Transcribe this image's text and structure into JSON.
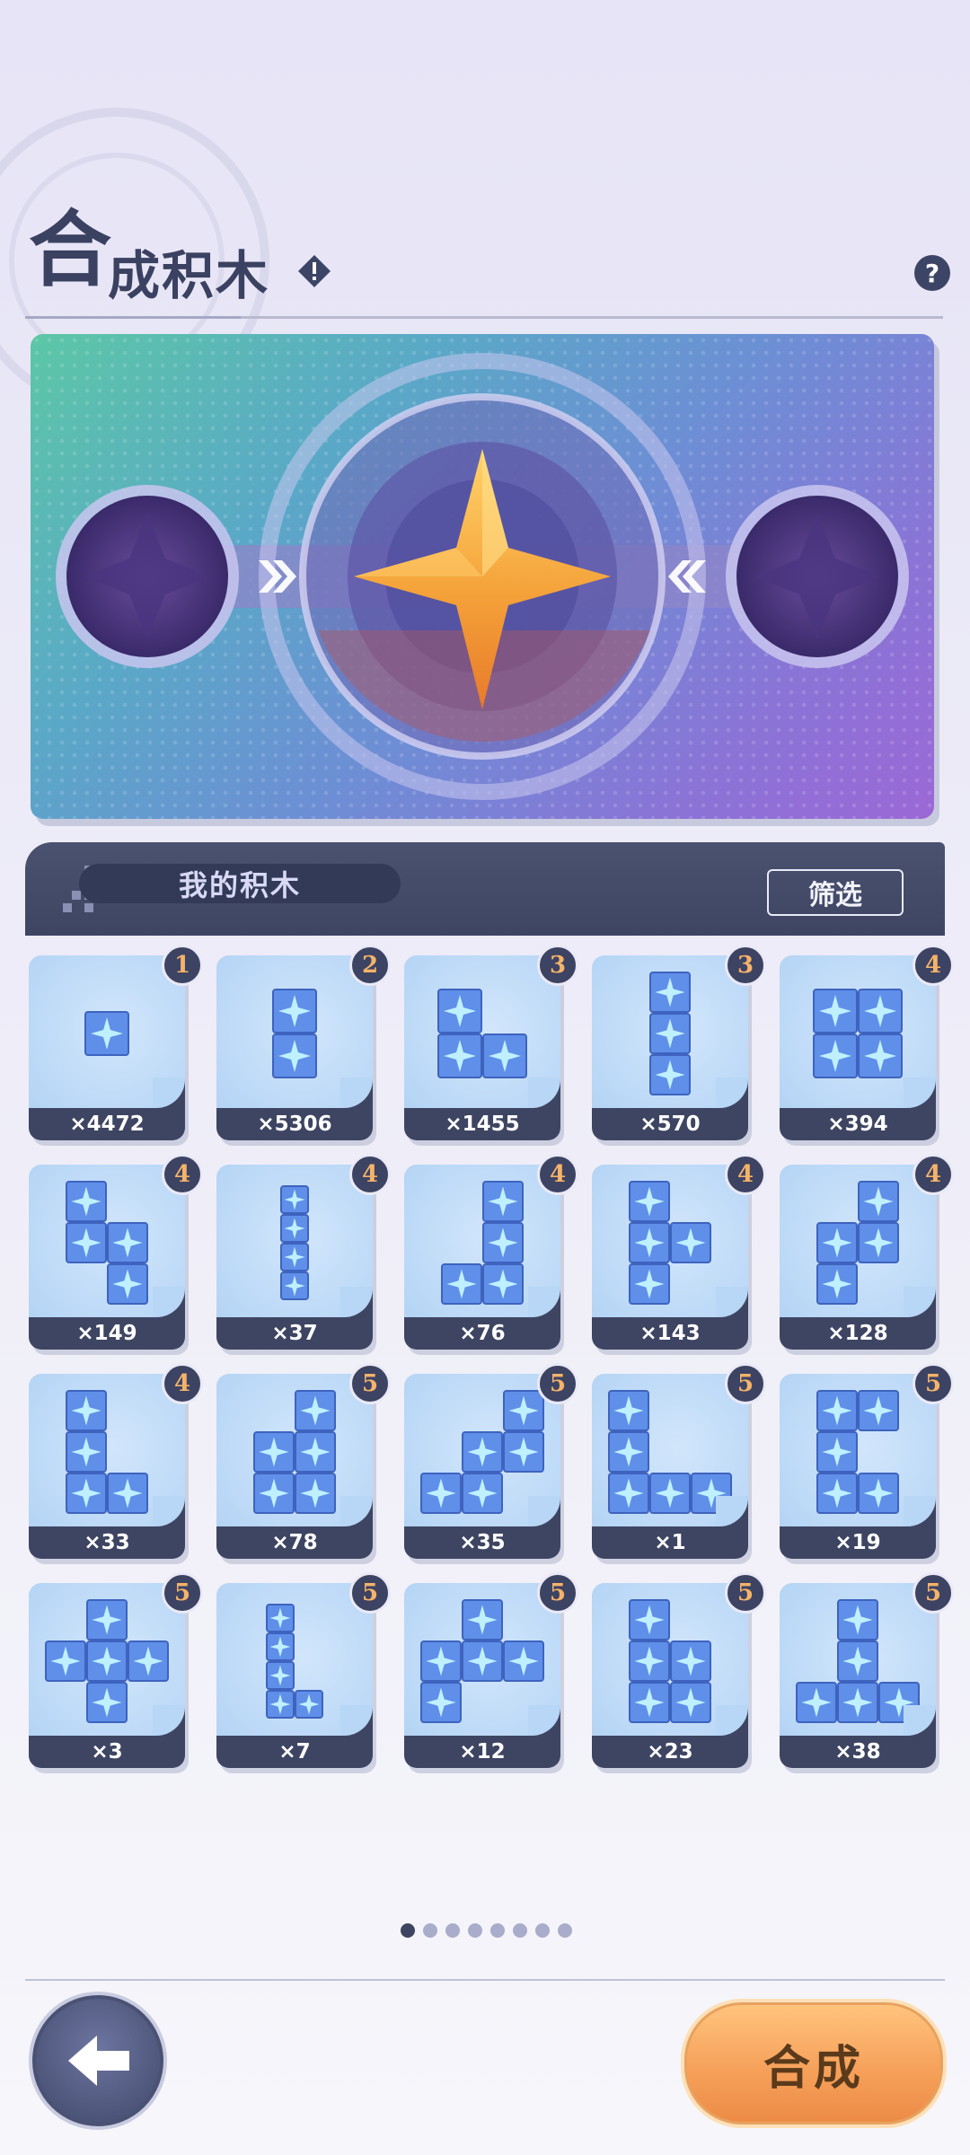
{
  "header": {
    "title_first": "合",
    "title_rest": "成积木",
    "warn_icon": "warning-diamond-icon",
    "help_icon": "question-icon",
    "help_glyph": "?"
  },
  "banner": {
    "left_slot": "empty-slot",
    "right_slot": "empty-slot",
    "center": "gold-star-core"
  },
  "inventory": {
    "title": "我的积木",
    "filter_label": "筛选"
  },
  "blocks": [
    {
      "tier": "1",
      "count": "×4472",
      "cells": [
        [
          0,
          0
        ]
      ]
    },
    {
      "tier": "2",
      "count": "×5306",
      "cells": [
        [
          0,
          0
        ],
        [
          0,
          1
        ]
      ]
    },
    {
      "tier": "3",
      "count": "×1455",
      "cells": [
        [
          0,
          0
        ],
        [
          0,
          1
        ],
        [
          1,
          1
        ]
      ]
    },
    {
      "tier": "3",
      "count": "×570",
      "cells": [
        [
          0,
          0
        ],
        [
          0,
          1
        ],
        [
          0,
          2
        ]
      ]
    },
    {
      "tier": "4",
      "count": "×394",
      "cells": [
        [
          0,
          0
        ],
        [
          1,
          0
        ],
        [
          0,
          1
        ],
        [
          1,
          1
        ]
      ]
    },
    {
      "tier": "4",
      "count": "×149",
      "cells": [
        [
          0,
          0
        ],
        [
          0,
          1
        ],
        [
          1,
          1
        ],
        [
          1,
          2
        ]
      ]
    },
    {
      "tier": "4",
      "count": "×37",
      "cells": [
        [
          0,
          0
        ],
        [
          0,
          1
        ],
        [
          0,
          2
        ],
        [
          0,
          3
        ]
      ]
    },
    {
      "tier": "4",
      "count": "×76",
      "cells": [
        [
          1,
          0
        ],
        [
          1,
          1
        ],
        [
          0,
          2
        ],
        [
          1,
          2
        ]
      ]
    },
    {
      "tier": "4",
      "count": "×143",
      "cells": [
        [
          0,
          0
        ],
        [
          0,
          1
        ],
        [
          1,
          1
        ],
        [
          0,
          2
        ]
      ]
    },
    {
      "tier": "4",
      "count": "×128",
      "cells": [
        [
          1,
          0
        ],
        [
          0,
          1
        ],
        [
          1,
          1
        ],
        [
          0,
          2
        ]
      ]
    },
    {
      "tier": "4",
      "count": "×33",
      "cells": [
        [
          0,
          0
        ],
        [
          0,
          1
        ],
        [
          0,
          2
        ],
        [
          1,
          2
        ]
      ]
    },
    {
      "tier": "5",
      "count": "×78",
      "cells": [
        [
          1,
          0
        ],
        [
          0,
          1
        ],
        [
          1,
          1
        ],
        [
          0,
          2
        ],
        [
          1,
          2
        ]
      ]
    },
    {
      "tier": "5",
      "count": "×35",
      "cells": [
        [
          2,
          0
        ],
        [
          1,
          1
        ],
        [
          2,
          1
        ],
        [
          0,
          2
        ],
        [
          1,
          2
        ]
      ]
    },
    {
      "tier": "5",
      "count": "×1",
      "cells": [
        [
          0,
          0
        ],
        [
          0,
          1
        ],
        [
          0,
          2
        ],
        [
          1,
          2
        ],
        [
          2,
          2
        ]
      ]
    },
    {
      "tier": "5",
      "count": "×19",
      "cells": [
        [
          0,
          0
        ],
        [
          1,
          0
        ],
        [
          0,
          1
        ],
        [
          0,
          2
        ],
        [
          1,
          2
        ]
      ]
    },
    {
      "tier": "5",
      "count": "×3",
      "cells": [
        [
          1,
          0
        ],
        [
          0,
          1
        ],
        [
          1,
          1
        ],
        [
          2,
          1
        ],
        [
          1,
          2
        ]
      ]
    },
    {
      "tier": "5",
      "count": "×7",
      "cells": [
        [
          0,
          0
        ],
        [
          0,
          1
        ],
        [
          0,
          2
        ],
        [
          0,
          3
        ],
        [
          1,
          3
        ]
      ]
    },
    {
      "tier": "5",
      "count": "×12",
      "cells": [
        [
          1,
          0
        ],
        [
          0,
          1
        ],
        [
          1,
          1
        ],
        [
          2,
          1
        ],
        [
          0,
          2
        ]
      ]
    },
    {
      "tier": "5",
      "count": "×23",
      "cells": [
        [
          0,
          0
        ],
        [
          0,
          1
        ],
        [
          1,
          1
        ],
        [
          0,
          2
        ],
        [
          1,
          2
        ]
      ]
    },
    {
      "tier": "5",
      "count": "×38",
      "cells": [
        [
          1,
          0
        ],
        [
          1,
          1
        ],
        [
          0,
          2
        ],
        [
          1,
          2
        ],
        [
          2,
          2
        ]
      ]
    }
  ],
  "pagination": {
    "pages": 8,
    "active": 0
  },
  "footer": {
    "back_icon": "back-arrow-icon",
    "synth_label": "合成"
  },
  "colors": {
    "accent": "#3e4562",
    "button": "#f6a15b",
    "badge_text": "#f5b36a"
  }
}
